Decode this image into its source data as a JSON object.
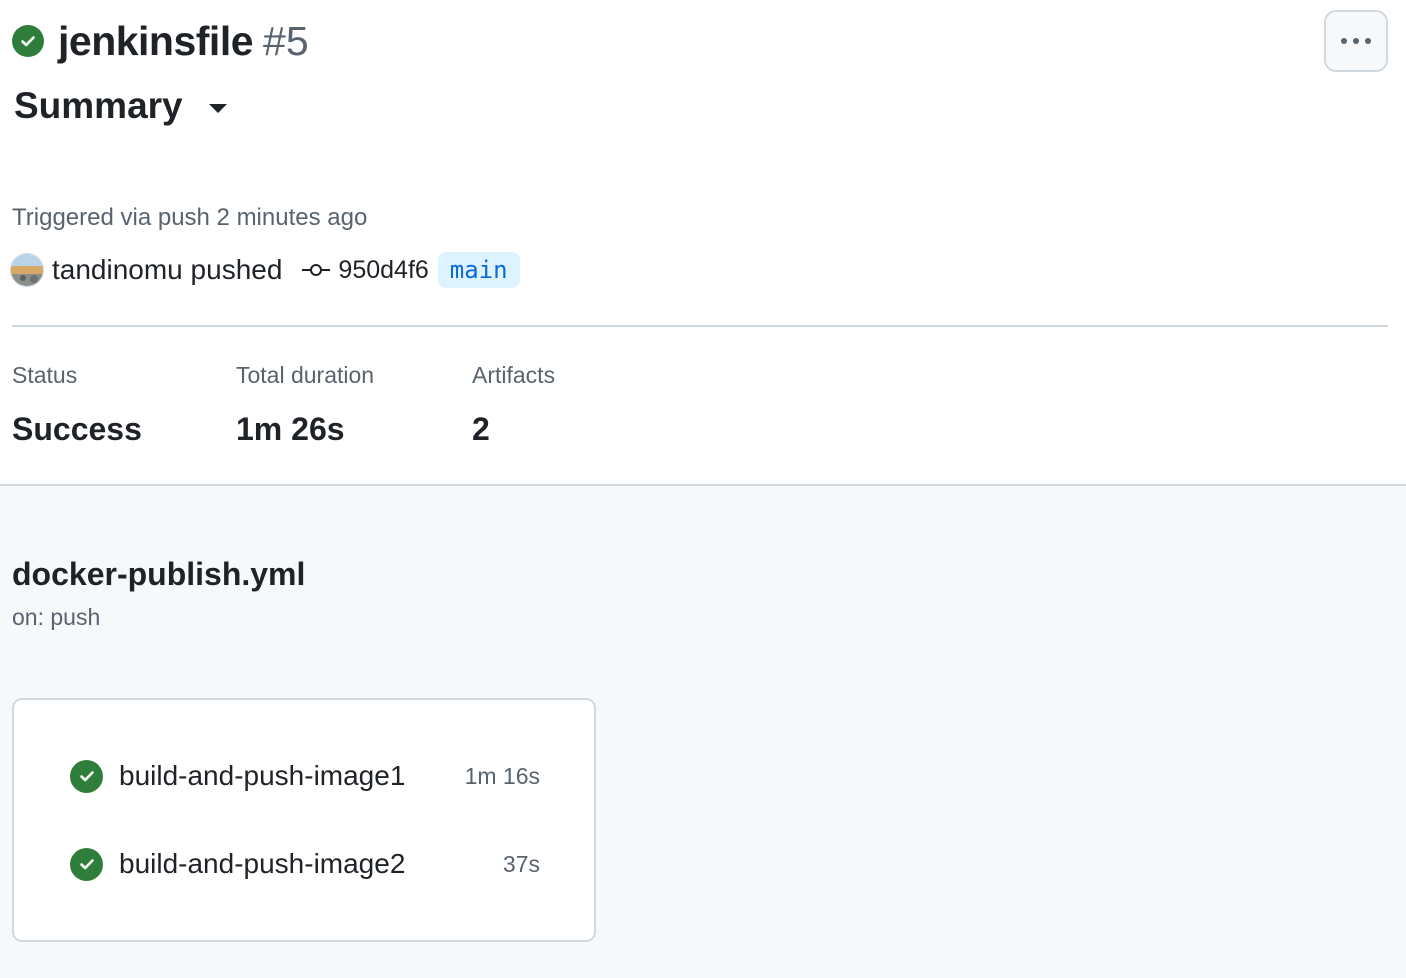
{
  "header": {
    "workflow_run_name": "jenkinsfile",
    "run_number": "#5",
    "more_label": "...",
    "view_label": "Summary"
  },
  "trigger": {
    "text": "Triggered via push 2 minutes ago",
    "actor": "tandinomu",
    "action": "pushed",
    "commit_sha": "950d4f6",
    "branch": "main"
  },
  "stats": {
    "status_label": "Status",
    "status_value": "Success",
    "duration_label": "Total duration",
    "duration_value": "1m 26s",
    "artifacts_label": "Artifacts",
    "artifacts_value": "2"
  },
  "workflow": {
    "file_name": "docker-publish.yml",
    "on": "on: push",
    "jobs": [
      {
        "name": "build-and-push-image1",
        "duration": "1m 16s",
        "status": "success"
      },
      {
        "name": "build-and-push-image2",
        "duration": "37s",
        "status": "success"
      }
    ]
  },
  "colors": {
    "success": "#2f7d3b",
    "branch_bg": "#ddf4ff",
    "branch_text": "#0969da",
    "muted_text": "#59636e",
    "border": "#d1d9e0"
  },
  "icons": {
    "status": "check-circle-icon",
    "more": "kebab-horizontal-icon",
    "dropdown": "caret-down-icon",
    "commit": "git-commit-icon",
    "avatar": "user-avatar"
  }
}
